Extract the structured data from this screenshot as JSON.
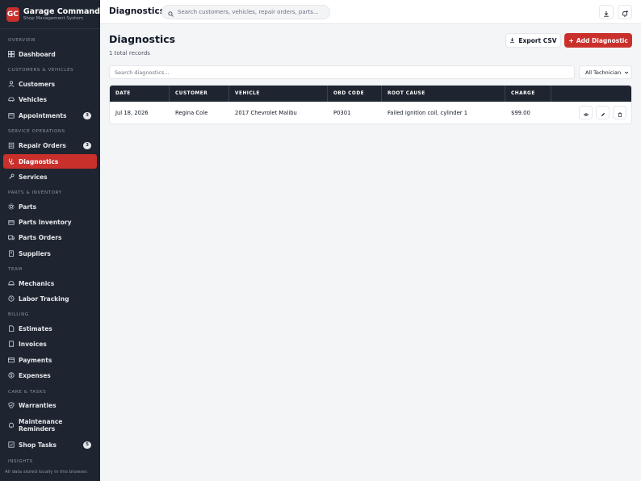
{
  "brand": {
    "logo": "GC",
    "title": "Garage Command",
    "subtitle": "Shop Management System"
  },
  "sidebar": {
    "sections": [
      "Overview",
      "Customers & Vehicles",
      "Service Operations",
      "Parts & Inventory",
      "Team",
      "Billing",
      "Care & Tasks",
      "Insights"
    ],
    "items": [
      {
        "label": "Dashboard",
        "icon": "grid-icon"
      },
      {
        "label": "Customers",
        "icon": "users-icon"
      },
      {
        "label": "Vehicles",
        "icon": "car-icon"
      },
      {
        "label": "Appointments",
        "icon": "calendar-icon",
        "badge": "3"
      },
      {
        "label": "Repair Orders",
        "icon": "clipboard-icon",
        "badge": "3"
      },
      {
        "label": "Diagnostics",
        "icon": "stethoscope-icon"
      },
      {
        "label": "Services",
        "icon": "wrench-icon"
      },
      {
        "label": "Parts",
        "icon": "gear-icon"
      },
      {
        "label": "Parts Inventory",
        "icon": "boxes-icon"
      },
      {
        "label": "Parts Orders",
        "icon": "truck-icon"
      },
      {
        "label": "Suppliers",
        "icon": "building-icon"
      },
      {
        "label": "Mechanics",
        "icon": "hardhat-icon"
      },
      {
        "label": "Labor Tracking",
        "icon": "clock-icon"
      },
      {
        "label": "Estimates",
        "icon": "document-icon"
      },
      {
        "label": "Invoices",
        "icon": "receipt-icon"
      },
      {
        "label": "Payments",
        "icon": "credit-card-icon"
      },
      {
        "label": "Expenses",
        "icon": "dollar-icon"
      },
      {
        "label": "Warranties",
        "icon": "shield-icon"
      },
      {
        "label": "Maintenance Reminders",
        "icon": "bell-icon"
      },
      {
        "label": "Shop Tasks",
        "icon": "checkbox-icon",
        "badge": "5"
      }
    ],
    "footer": "All data stored locally in this browser."
  },
  "topbar": {
    "title": "Diagnostics",
    "search_placeholder": "Search customers, vehicles, repair orders, parts...",
    "icons": [
      "download-icon",
      "notification-icon"
    ]
  },
  "main": {
    "title": "Diagnostics",
    "records": "1 total records",
    "export_label": "Export CSV",
    "add_label": "Add Diagnostic",
    "filter_placeholder": "Search diagnostics...",
    "technician_filter": "All Technician",
    "columns": [
      "Date",
      "Customer",
      "Vehicle",
      "OBD Code",
      "Root Cause",
      "Charge"
    ],
    "rows": [
      {
        "date": "Jul 18, 2026",
        "customer": "Regina Cole",
        "vehicle": "2017 Chevrolet Malibu",
        "obd": "P0301",
        "cause": "Failed ignition coil, cylinder 1",
        "charge": "$99.00"
      }
    ]
  },
  "colors": {
    "accent": "#c9302c",
    "sidebar": "#1e2530",
    "background": "#f4f5f7"
  }
}
